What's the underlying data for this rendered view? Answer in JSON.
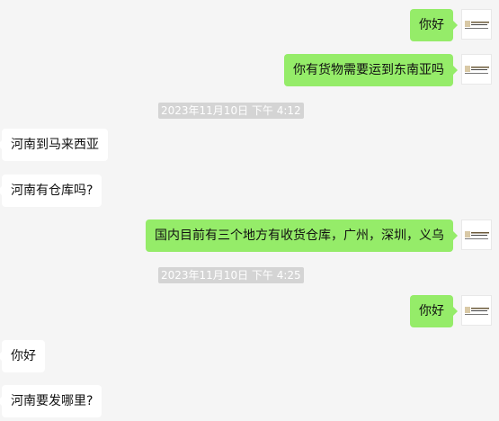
{
  "messages": [
    {
      "side": "out",
      "text": "你好"
    },
    {
      "side": "out",
      "text": "你有货物需要运到东南亚吗"
    },
    {
      "type": "time",
      "text": "2023年11月10日 下午 4:12"
    },
    {
      "side": "in",
      "text": "河南到马来西亚"
    },
    {
      "side": "in",
      "text": "河南有仓库吗?"
    },
    {
      "side": "out",
      "text": "国内目前有三个地方有收货仓库，广州，深圳，义乌"
    },
    {
      "type": "time",
      "text": "2023年11月10日 下午 4:25"
    },
    {
      "side": "out",
      "text": "你好"
    },
    {
      "side": "in",
      "text": "你好"
    },
    {
      "side": "in",
      "text": "河南要发哪里?"
    }
  ],
  "colors": {
    "background": "#f5f5f5",
    "outgoing_bubble": "#95ec69",
    "incoming_bubble": "#ffffff",
    "timestamp_bg": "#d4d4d4"
  },
  "icons": {
    "avatar": "company-logo-avatar"
  }
}
